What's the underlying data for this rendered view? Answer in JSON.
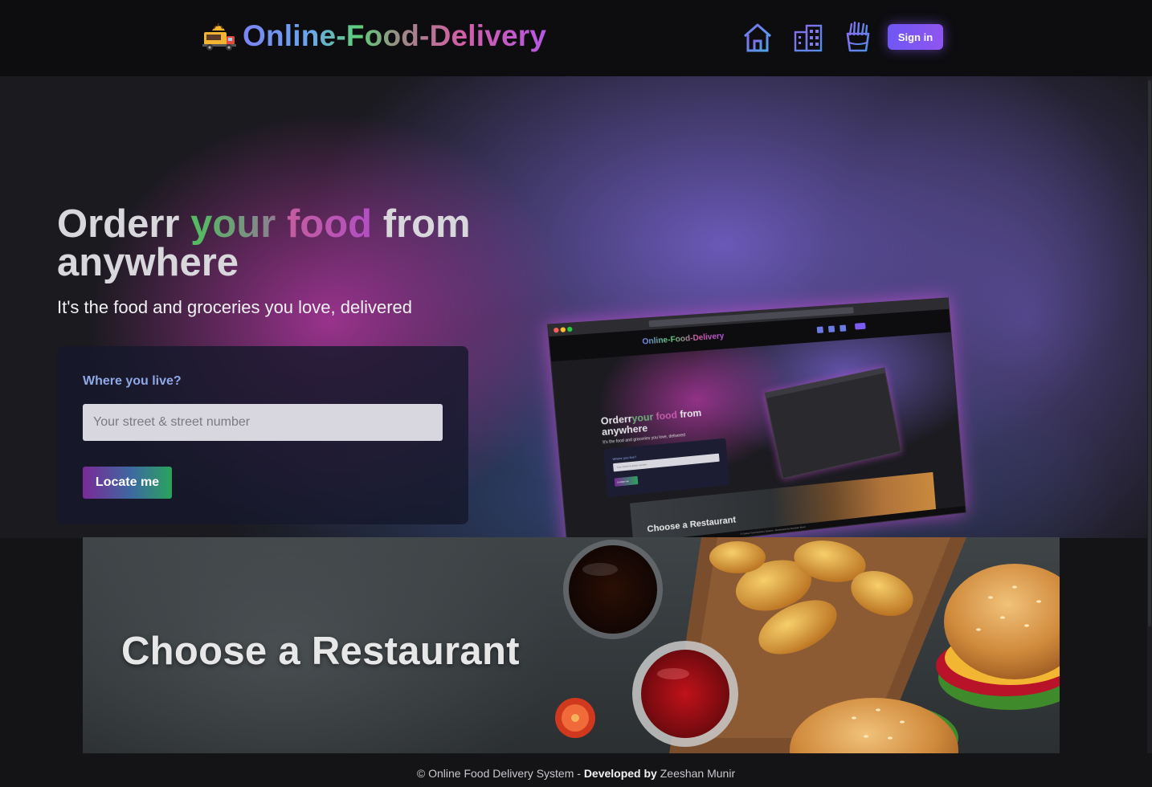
{
  "navbar": {
    "brand": "Online-Food-Delivery",
    "logo_icon": "food-truck-icon",
    "links": [
      {
        "name": "home",
        "icon": "home-icon"
      },
      {
        "name": "restaurants",
        "icon": "buildings-icon"
      },
      {
        "name": "food",
        "icon": "fries-icon"
      }
    ],
    "signin_label": "Sign in"
  },
  "hero": {
    "title_order": "Orderr",
    "title_your": "your",
    "title_food": "food",
    "title_from": "from",
    "title_anywhere": "anywhere",
    "subtitle": "It's the food and groceries you love, delivered",
    "locate": {
      "label": "Where you live?",
      "placeholder": "Your street & street number",
      "value": "",
      "button_label": "Locate me"
    }
  },
  "preview": {
    "brand": "Online-Food-Delivery",
    "title_order": "Orderr",
    "title_your": "your",
    "title_food": "food",
    "title_from": "from",
    "title_anywhere": "anywhere",
    "subtitle": "It's the food and groceries you love, delivered",
    "locate_label": "Where you live?",
    "locate_placeholder": "Your street & street number",
    "locate_button": "Locate me",
    "banner_title": "Choose a Restaurant",
    "footer": "© Online Food Delivery System - Developed by Zeeshan Munir"
  },
  "restaurant_banner": {
    "title": "Choose a Restaurant"
  },
  "footer": {
    "prefix": "© Online Food Delivery System - ",
    "developed_by": "Developed by",
    "author": " Zeeshan Munir"
  },
  "colors": {
    "brand_gradient_start": "#7b84f2",
    "brand_gradient_mid": "#5fcf7a",
    "brand_gradient_end": "#b657e3",
    "signin_accent": "#7c5bf2",
    "background": "#141416"
  }
}
